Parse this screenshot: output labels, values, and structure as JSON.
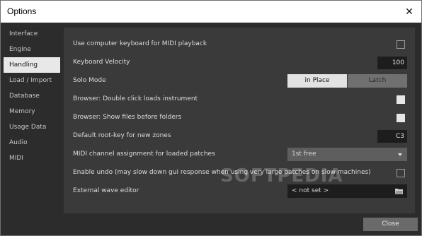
{
  "window": {
    "title": "Options",
    "close_glyph": "✕"
  },
  "sidebar": {
    "items": [
      {
        "label": "Interface"
      },
      {
        "label": "Engine"
      },
      {
        "label": "Handling"
      },
      {
        "label": "Load / Import"
      },
      {
        "label": "Database"
      },
      {
        "label": "Memory"
      },
      {
        "label": "Usage Data"
      },
      {
        "label": "Audio"
      },
      {
        "label": "MIDI"
      }
    ],
    "active": "Handling"
  },
  "settings": {
    "computer_keyboard": {
      "label": "Use computer keyboard for MIDI playback",
      "checked": false
    },
    "keyboard_velocity": {
      "label": "Keyboard Velocity",
      "value": "100"
    },
    "solo_mode": {
      "label": "Solo Mode",
      "options": [
        "in Place",
        "Latch"
      ],
      "selected": "in Place"
    },
    "browser_double_click": {
      "label": "Browser: Double click loads instrument",
      "checked": true
    },
    "browser_files_first": {
      "label": "Browser: Show files before folders",
      "checked": true
    },
    "root_key": {
      "label": "Default root-key for new zones",
      "value": "C3"
    },
    "midi_channel": {
      "label": "MIDI channel assignment for loaded patches",
      "value": "1st free"
    },
    "enable_undo": {
      "label": "Enable undo (may slow down gui response when using very large patches on slow machines)",
      "checked": false
    },
    "wave_editor": {
      "label": "External wave editor",
      "value": "< not set >"
    }
  },
  "footer": {
    "close_label": "Close"
  },
  "watermark": "SOFTPEDIA",
  "colors": {
    "panel": "#3a3a3a",
    "active_nav": "#e8e8e8",
    "field": "#1d1d1d"
  },
  "icons": [
    "close-icon",
    "dropdown-arrow-icon",
    "folder-icon"
  ]
}
